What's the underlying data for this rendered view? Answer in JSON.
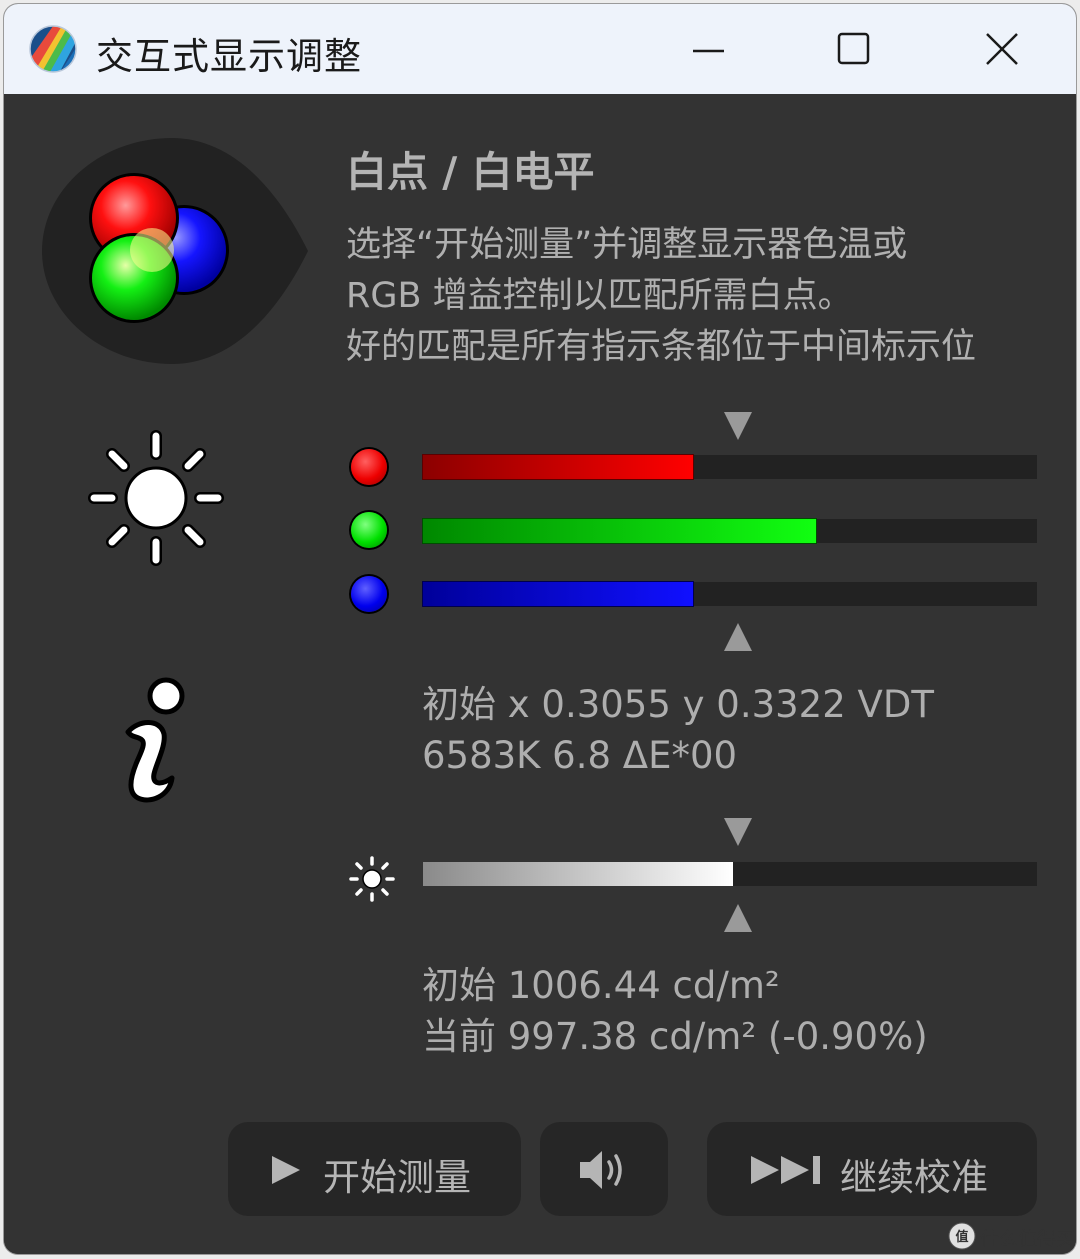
{
  "window": {
    "title": "交互式显示调整",
    "controls": [
      "minimize",
      "maximize",
      "close"
    ]
  },
  "panel": {
    "heading": "白点 / 白电平",
    "description": "选择“开始测量”并调整显示器色温或\nRGB 增益控制以匹配所需白点。\n好的匹配是所有指示条都位于中间标示位"
  },
  "icons": [
    "rgb-color-icon",
    "brightness-sun-icon",
    "info-icon",
    "small-sun-icon"
  ],
  "rgb_bars": [
    {
      "channel": "red",
      "color": "#ff0000",
      "level": 0.44
    },
    {
      "channel": "green",
      "color": "#00ff00",
      "level": 0.64
    },
    {
      "channel": "blue",
      "color": "#0000ff",
      "level": 0.44
    }
  ],
  "rgb_target_level": 0.51,
  "white_point": {
    "line1": "初始 x 0.3055 y 0.3322 VDT",
    "line2": "6583K 6.8 ΔE*00"
  },
  "luminance_bar": {
    "level": 0.505,
    "target_level": 0.51
  },
  "luminance": {
    "line1": "初始 1006.44 cd/m²",
    "line2": "当前 997.38 cd/m² (-0.90%)"
  },
  "buttons": {
    "start": "开始测量",
    "sound": "speaker-icon",
    "continue": "继续校准"
  },
  "watermark": {
    "text": "什么值得买"
  },
  "colors": {
    "accent_red": "#ff0000",
    "accent_green": "#00ff00",
    "accent_blue": "#0000ff",
    "background": "#333333"
  }
}
